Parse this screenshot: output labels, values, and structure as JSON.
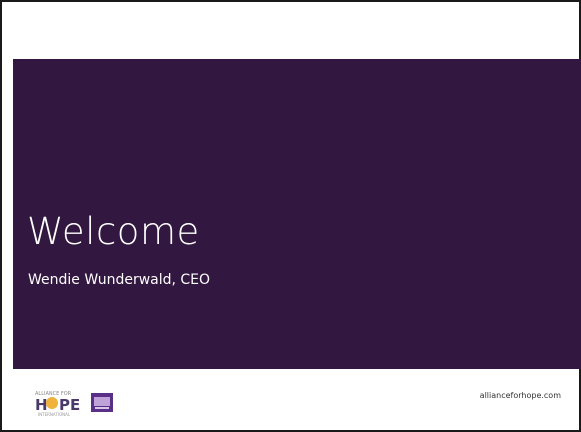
{
  "slide": {
    "title": "Welcome",
    "subtitle": "Wendie Wunderwald, CEO",
    "website": "allianceforhope.com",
    "logos": {
      "primary_logo_word": "HOPE",
      "secondary_logo": "partner-logo"
    },
    "colors": {
      "band": "#321740",
      "text_on_band": "#ffffff",
      "website_text": "#333333",
      "logo_gold": "#f0b23a",
      "logo_purple": "#5a2f87"
    }
  }
}
